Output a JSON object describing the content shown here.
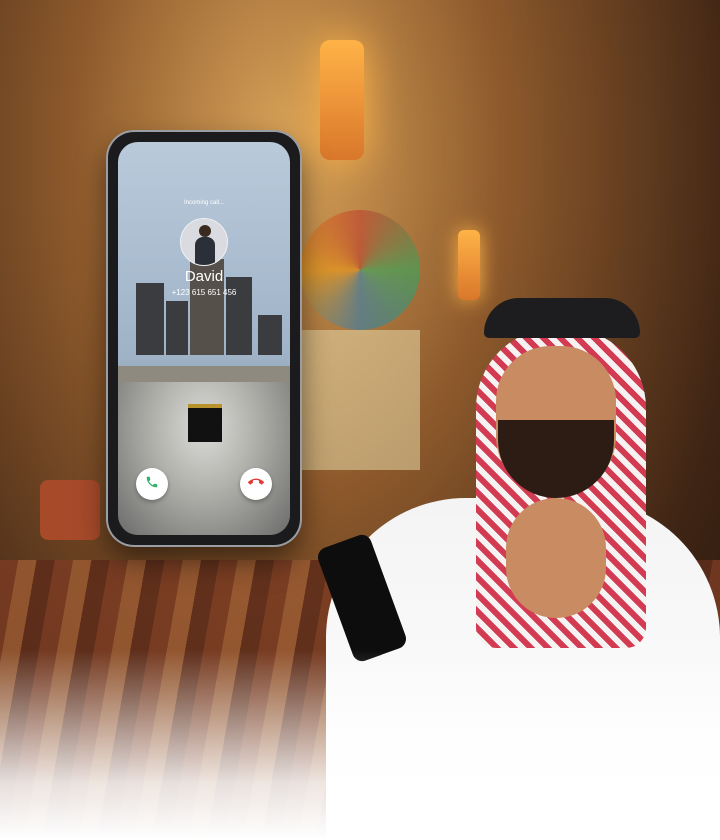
{
  "call": {
    "status": "Incoming call...",
    "caller_name": "David",
    "caller_number": "+123 615 651 456"
  },
  "icons": {
    "accept": "phone-accept-icon",
    "decline": "phone-decline-icon"
  },
  "colors": {
    "accept": "#2fb36d",
    "decline": "#e53935"
  }
}
